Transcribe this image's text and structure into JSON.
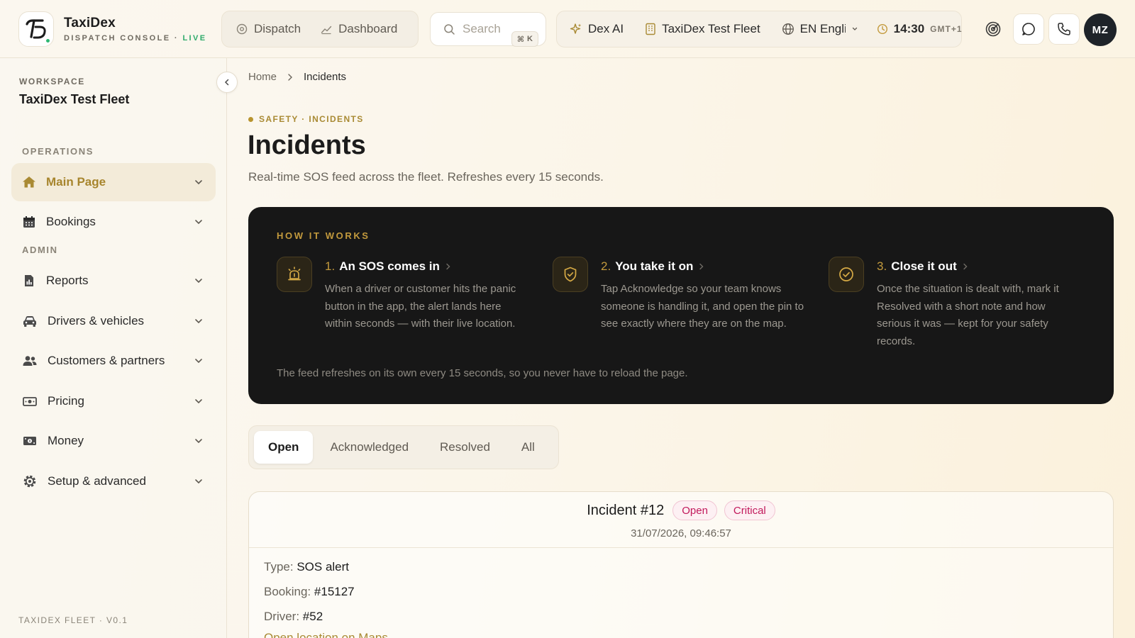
{
  "brand": {
    "name": "TaxiDex",
    "subtitle": "DISPATCH CONSOLE",
    "separator": " · ",
    "live": "LIVE"
  },
  "topnav": {
    "dispatch": "Dispatch",
    "dashboard": "Dashboard"
  },
  "search": {
    "placeholder": "Search",
    "shortcut_symbol": "⌘",
    "shortcut_key": "K"
  },
  "status": {
    "ai_label": "Dex AI",
    "fleet": "TaxiDex Test Fleet",
    "language": "EN English",
    "time": "14:30",
    "timezone": "GMT+1"
  },
  "user": {
    "initials": "MZ"
  },
  "sidebar": {
    "workspace_label": "WORKSPACE",
    "workspace_name": "TaxiDex Test Fleet",
    "operations_label": "OPERATIONS",
    "admin_label": "ADMIN",
    "items": [
      {
        "label": "Main Page",
        "icon": "home-icon",
        "active": true
      },
      {
        "label": "Bookings",
        "icon": "calendar-icon"
      },
      {
        "label": "Reports",
        "icon": "report-icon"
      },
      {
        "label": "Drivers & vehicles",
        "icon": "car-icon"
      },
      {
        "label": "Customers & partners",
        "icon": "users-icon"
      },
      {
        "label": "Pricing",
        "icon": "banknote-icon"
      },
      {
        "label": "Money",
        "icon": "money-icon"
      },
      {
        "label": "Setup & advanced",
        "icon": "settings-icon"
      }
    ],
    "version": "TAXIDEX FLEET · V0.1"
  },
  "breadcrumb": {
    "home": "Home",
    "current": "Incidents"
  },
  "page": {
    "eyebrow": "SAFETY · INCIDENTS",
    "title": "Incidents",
    "subtitle": "Real-time SOS feed across the fleet. Refreshes every 15 seconds."
  },
  "how_it_works": {
    "title": "HOW IT WORKS",
    "steps": [
      {
        "num": "1.",
        "title": "An SOS comes in",
        "body": "When a driver or customer hits the panic button in the app, the alert lands here within seconds — with their live location."
      },
      {
        "num": "2.",
        "title": "You take it on",
        "body": "Tap Acknowledge so your team knows someone is handling it, and open the pin to see exactly where they are on the map."
      },
      {
        "num": "3.",
        "title": "Close it out",
        "body": "Once the situation is dealt with, mark it Resolved with a short note and how serious it was — kept for your safety records."
      }
    ],
    "footer": "The feed refreshes on its own every 15 seconds, so you never have to reload the page."
  },
  "tabs": [
    {
      "label": "Open"
    },
    {
      "label": "Acknowledged"
    },
    {
      "label": "Resolved"
    },
    {
      "label": "All"
    }
  ],
  "incident": {
    "title": "Incident #12",
    "status": "Open",
    "severity": "Critical",
    "datetime": "31/07/2026, 09:46:57",
    "type_label": "Type:",
    "type": "SOS alert",
    "booking_label": "Booking:",
    "booking": "#15127",
    "driver_label": "Driver:",
    "driver": "#52",
    "maps_link": "Open location on Maps"
  },
  "colors": {
    "accent": "#a98a34",
    "dark_panel": "#171717",
    "badge": "#c2185b",
    "live": "#2eaa6a"
  }
}
